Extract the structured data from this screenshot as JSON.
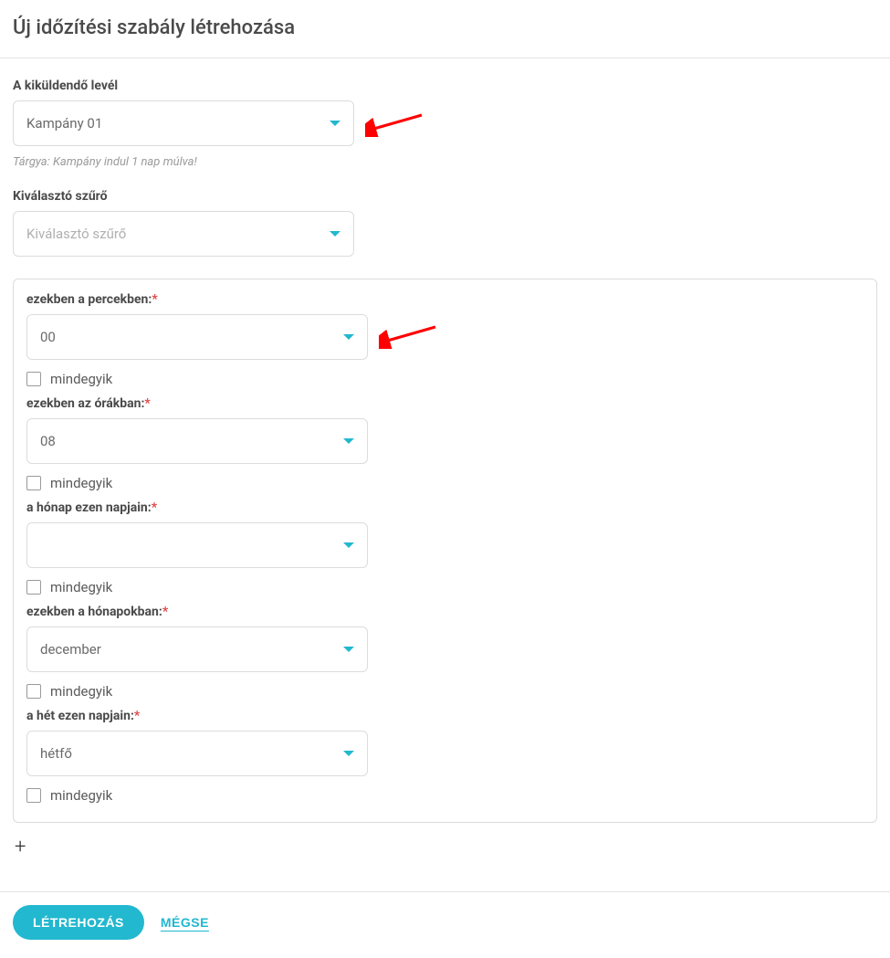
{
  "header": {
    "title": "Új időzítési szabály létrehozása"
  },
  "emailSection": {
    "label": "A kiküldendő levél",
    "value": "Kampány 01",
    "helper": "Tárgya: Kampány indul 1 nap múlva!"
  },
  "filterSection": {
    "label": "Kiválasztó szűrő",
    "placeholder": "Kiválasztó szűrő"
  },
  "schedule": {
    "allLabel": "mindegyik",
    "minutes": {
      "label": "ezekben a percekben:",
      "value": "00"
    },
    "hours": {
      "label": "ezekben az órákban:",
      "value": "08"
    },
    "daysOfMonth": {
      "label": "a hónap ezen napjain:",
      "value": ""
    },
    "months": {
      "label": "ezekben a hónapokban:",
      "value": "december"
    },
    "daysOfWeek": {
      "label": "a hét ezen napjain:",
      "value": "hétfő"
    }
  },
  "footer": {
    "create": "LÉTREHOZÁS",
    "cancel": "MÉGSE"
  }
}
